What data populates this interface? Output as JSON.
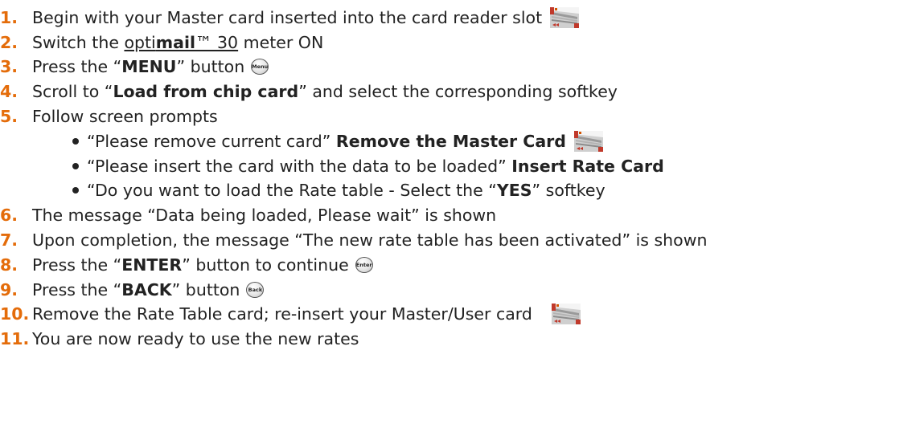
{
  "steps": [
    {
      "n": "1.",
      "t1": "Begin with your Master card inserted into the card reader slot",
      "icon": "card-icon"
    },
    {
      "n": "2.",
      "t1": "Switch the ",
      "opti": "opti",
      "mail": "mail",
      "tm": "™ 30",
      "t2": " meter ON"
    },
    {
      "n": "3.",
      "t1": "Press the “",
      "b": "MENU",
      "t2": "” button",
      "btn": "Menu"
    },
    {
      "n": "4.",
      "t1": "Scroll to “",
      "b": "Load from chip card",
      "t2": "” and select the corresponding softkey"
    },
    {
      "n": "5.",
      "t1": "Follow screen prompts"
    },
    {
      "n": "6.",
      "t1": "The message “Data being loaded, Please wait” is shown"
    },
    {
      "n": "7.",
      "t1": "Upon completion, the message “The new rate table has been activated” is shown"
    },
    {
      "n": "8.",
      "t1": "Press the “",
      "b": "ENTER",
      "t2": "” button to continue",
      "btn": "Enter"
    },
    {
      "n": "9.",
      "t1": "Press the “",
      "b": "BACK",
      "t2": "” button",
      "btn": "Back"
    },
    {
      "n": "10.",
      "t1": "Remove the Rate Table card; re-insert your Master/User card",
      "icon": "card-icon"
    },
    {
      "n": "11.",
      "t1": "You are now ready to use the new rates"
    }
  ],
  "prompts": [
    {
      "t1": "“Please remove current card” ",
      "b": "Remove the Master Card",
      "icon": "card-icon"
    },
    {
      "t1": "“Please insert the card with the data to be loaded” ",
      "b": "Insert Rate Card"
    },
    {
      "t1": "“Do you want to load the Rate table - Select the “",
      "b": "YES",
      "t2": "” softkey"
    }
  ],
  "colors": {
    "number": "#e46c0a",
    "text": "#222222",
    "card_accent": "#c0392b"
  }
}
